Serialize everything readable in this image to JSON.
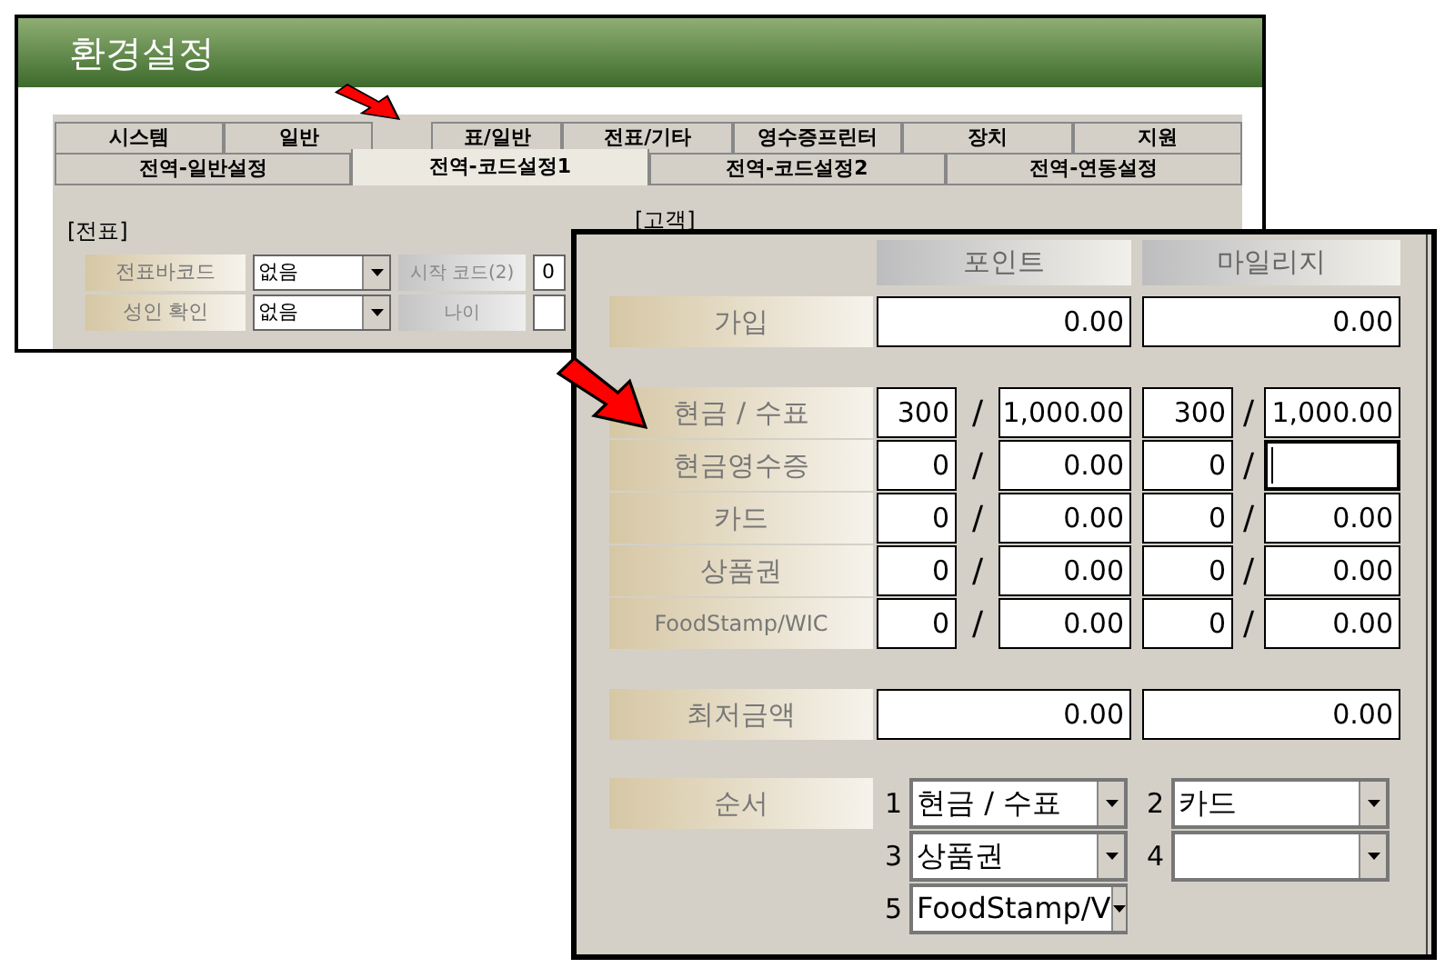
{
  "window": {
    "title": "환경설정"
  },
  "tabs_row1": [
    {
      "label": "시스템",
      "selected": false
    },
    {
      "label": "일반",
      "selected": false
    },
    {
      "label": "표/일반",
      "selected": false
    },
    {
      "label": "전표/기타",
      "selected": false
    },
    {
      "label": "영수증프린터",
      "selected": false
    },
    {
      "label": "장치",
      "selected": false
    },
    {
      "label": "지원",
      "selected": false
    }
  ],
  "tabs_row2": [
    {
      "label": "전역-일반설정",
      "selected": false
    },
    {
      "label": "전역-코드설정1",
      "selected": true
    },
    {
      "label": "전역-코드설정2",
      "selected": false
    },
    {
      "label": "전역-연동설정",
      "selected": false
    }
  ],
  "voucher_group": {
    "title": "[전표]",
    "rows": [
      {
        "label": "전표바코드",
        "select": "없음",
        "label_2": "시작 코드(2)",
        "value": "0"
      },
      {
        "label": "성인 확인",
        "select": "없음",
        "label_2": "나이"
      }
    ]
  },
  "customer_group": {
    "title": "[고객]"
  },
  "detail": {
    "columns": [
      "포인트",
      "마일리지"
    ],
    "rows": [
      {
        "kind": "single",
        "label": "가입",
        "point": "0.00",
        "mileage": "0.00"
      },
      {
        "kind": "gap"
      },
      {
        "kind": "pair",
        "label": "현금 / 수표",
        "point": {
          "count": "300",
          "amount": "1,000.00",
          "focused": false
        },
        "mileage": {
          "count": "300",
          "amount": "1,000.00",
          "focused": false
        }
      },
      {
        "kind": "pair",
        "label": "현금영수증",
        "point": {
          "count": "0",
          "amount": "0.00",
          "focused": false
        },
        "mileage": {
          "count": "0",
          "focused": true
        }
      },
      {
        "kind": "pair",
        "label": "카드",
        "point": {
          "count": "0",
          "amount": "0.00",
          "focused": false
        },
        "mileage": {
          "count": "0",
          "amount": "0.00",
          "focused": false
        }
      },
      {
        "kind": "pair",
        "label": "상품권",
        "point": {
          "count": "0",
          "amount": "0.00",
          "focused": false
        },
        "mileage": {
          "count": "0",
          "amount": "0.00",
          "focused": false
        }
      },
      {
        "kind": "pair",
        "label": "FoodStamp/WIC",
        "point": {
          "count": "0",
          "amount": "0.00",
          "focused": false
        },
        "mileage": {
          "count": "0",
          "amount": "0.00",
          "focused": false
        }
      },
      {
        "kind": "gap"
      },
      {
        "kind": "single",
        "label": "최저금액",
        "point": "0.00",
        "mileage": "0.00"
      }
    ],
    "separator": "/",
    "order": {
      "label": "순서",
      "items": [
        {
          "number": "1",
          "value": "현금 / 수표"
        },
        {
          "number": "2",
          "value": "카드"
        },
        {
          "number": "3",
          "value": "상품권"
        },
        {
          "number": "4"
        },
        {
          "number": "5",
          "value": "FoodStamp/V"
        }
      ]
    }
  }
}
